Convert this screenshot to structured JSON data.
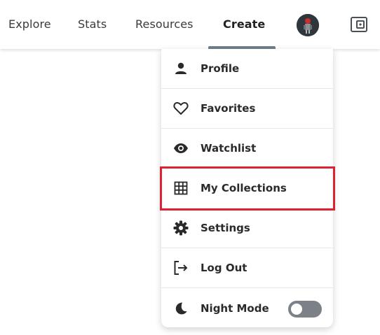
{
  "nav": {
    "links": [
      {
        "label": "Explore"
      },
      {
        "label": "Stats"
      },
      {
        "label": "Resources"
      },
      {
        "label": "Create"
      }
    ],
    "active": "Create",
    "avatar_icon": "user-avatar",
    "wallet_icon": "wallet-icon"
  },
  "menu": {
    "items": [
      {
        "label": "Profile",
        "icon": "person-icon"
      },
      {
        "label": "Favorites",
        "icon": "heart-icon"
      },
      {
        "label": "Watchlist",
        "icon": "eye-icon"
      },
      {
        "label": "My Collections",
        "icon": "grid-icon",
        "highlighted": true
      },
      {
        "label": "Settings",
        "icon": "gear-icon"
      },
      {
        "label": "Log Out",
        "icon": "logout-icon"
      },
      {
        "label": "Night Mode",
        "icon": "moon-icon",
        "toggle": false
      }
    ]
  },
  "colors": {
    "highlight": "#dd2233",
    "toggle_off": "#7c8187",
    "underline": "#6f7f8c"
  }
}
